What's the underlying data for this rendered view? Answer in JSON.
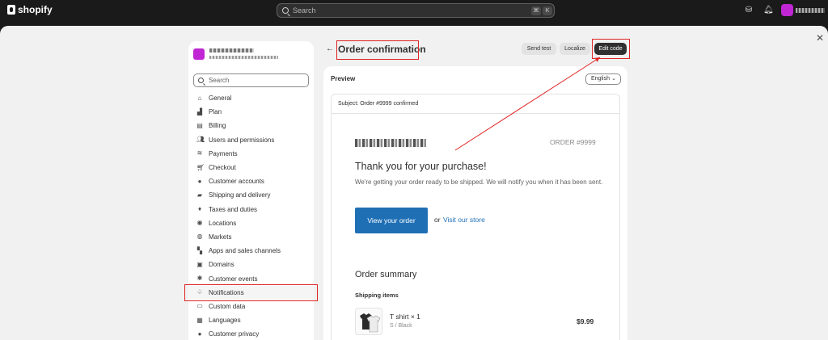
{
  "topbar": {
    "brand": "shopify",
    "search_placeholder": "Search",
    "shortcut_keys": [
      "⌘",
      "K"
    ],
    "icons": [
      "store-icon",
      "bell-icon"
    ]
  },
  "sidebar": {
    "search_placeholder": "Search",
    "items": [
      {
        "label": "General",
        "icon": "store-icon"
      },
      {
        "label": "Plan",
        "icon": "chart-icon"
      },
      {
        "label": "Billing",
        "icon": "receipt-icon"
      },
      {
        "label": "Users and permissions",
        "icon": "users-icon"
      },
      {
        "label": "Payments",
        "icon": "payments-icon"
      },
      {
        "label": "Checkout",
        "icon": "cart-icon"
      },
      {
        "label": "Customer accounts",
        "icon": "person-icon"
      },
      {
        "label": "Shipping and delivery",
        "icon": "truck-icon"
      },
      {
        "label": "Taxes and duties",
        "icon": "tax-icon"
      },
      {
        "label": "Locations",
        "icon": "location-icon"
      },
      {
        "label": "Markets",
        "icon": "globe-icon"
      },
      {
        "label": "Apps and sales channels",
        "icon": "apps-icon"
      },
      {
        "label": "Domains",
        "icon": "domain-icon"
      },
      {
        "label": "Customer events",
        "icon": "events-icon"
      },
      {
        "label": "Notifications",
        "icon": "bell-icon"
      },
      {
        "label": "Custom data",
        "icon": "data-icon"
      },
      {
        "label": "Languages",
        "icon": "language-icon"
      },
      {
        "label": "Customer privacy",
        "icon": "lock-icon"
      }
    ],
    "active_index": 14
  },
  "header": {
    "title": "Order confirmation",
    "buttons": {
      "send_test": "Send test",
      "localize": "Localize",
      "edit_code": "Edit code"
    }
  },
  "preview": {
    "label": "Preview",
    "language": "English",
    "subject": "Subject: Order #9999 confirmed",
    "order_number": "ORDER #9999",
    "heading": "Thank you for your purchase!",
    "message": "We're getting your order ready to be shipped. We will notify you when it has been sent.",
    "view_order": "View your order",
    "or": "or",
    "visit_store": "Visit our store",
    "order_summary": "Order summary",
    "shipping_items": "Shipping items",
    "product": {
      "title": "T shirt × 1",
      "variant": "S / Black",
      "price": "$9.99"
    }
  },
  "annotation_color": "#e02424"
}
